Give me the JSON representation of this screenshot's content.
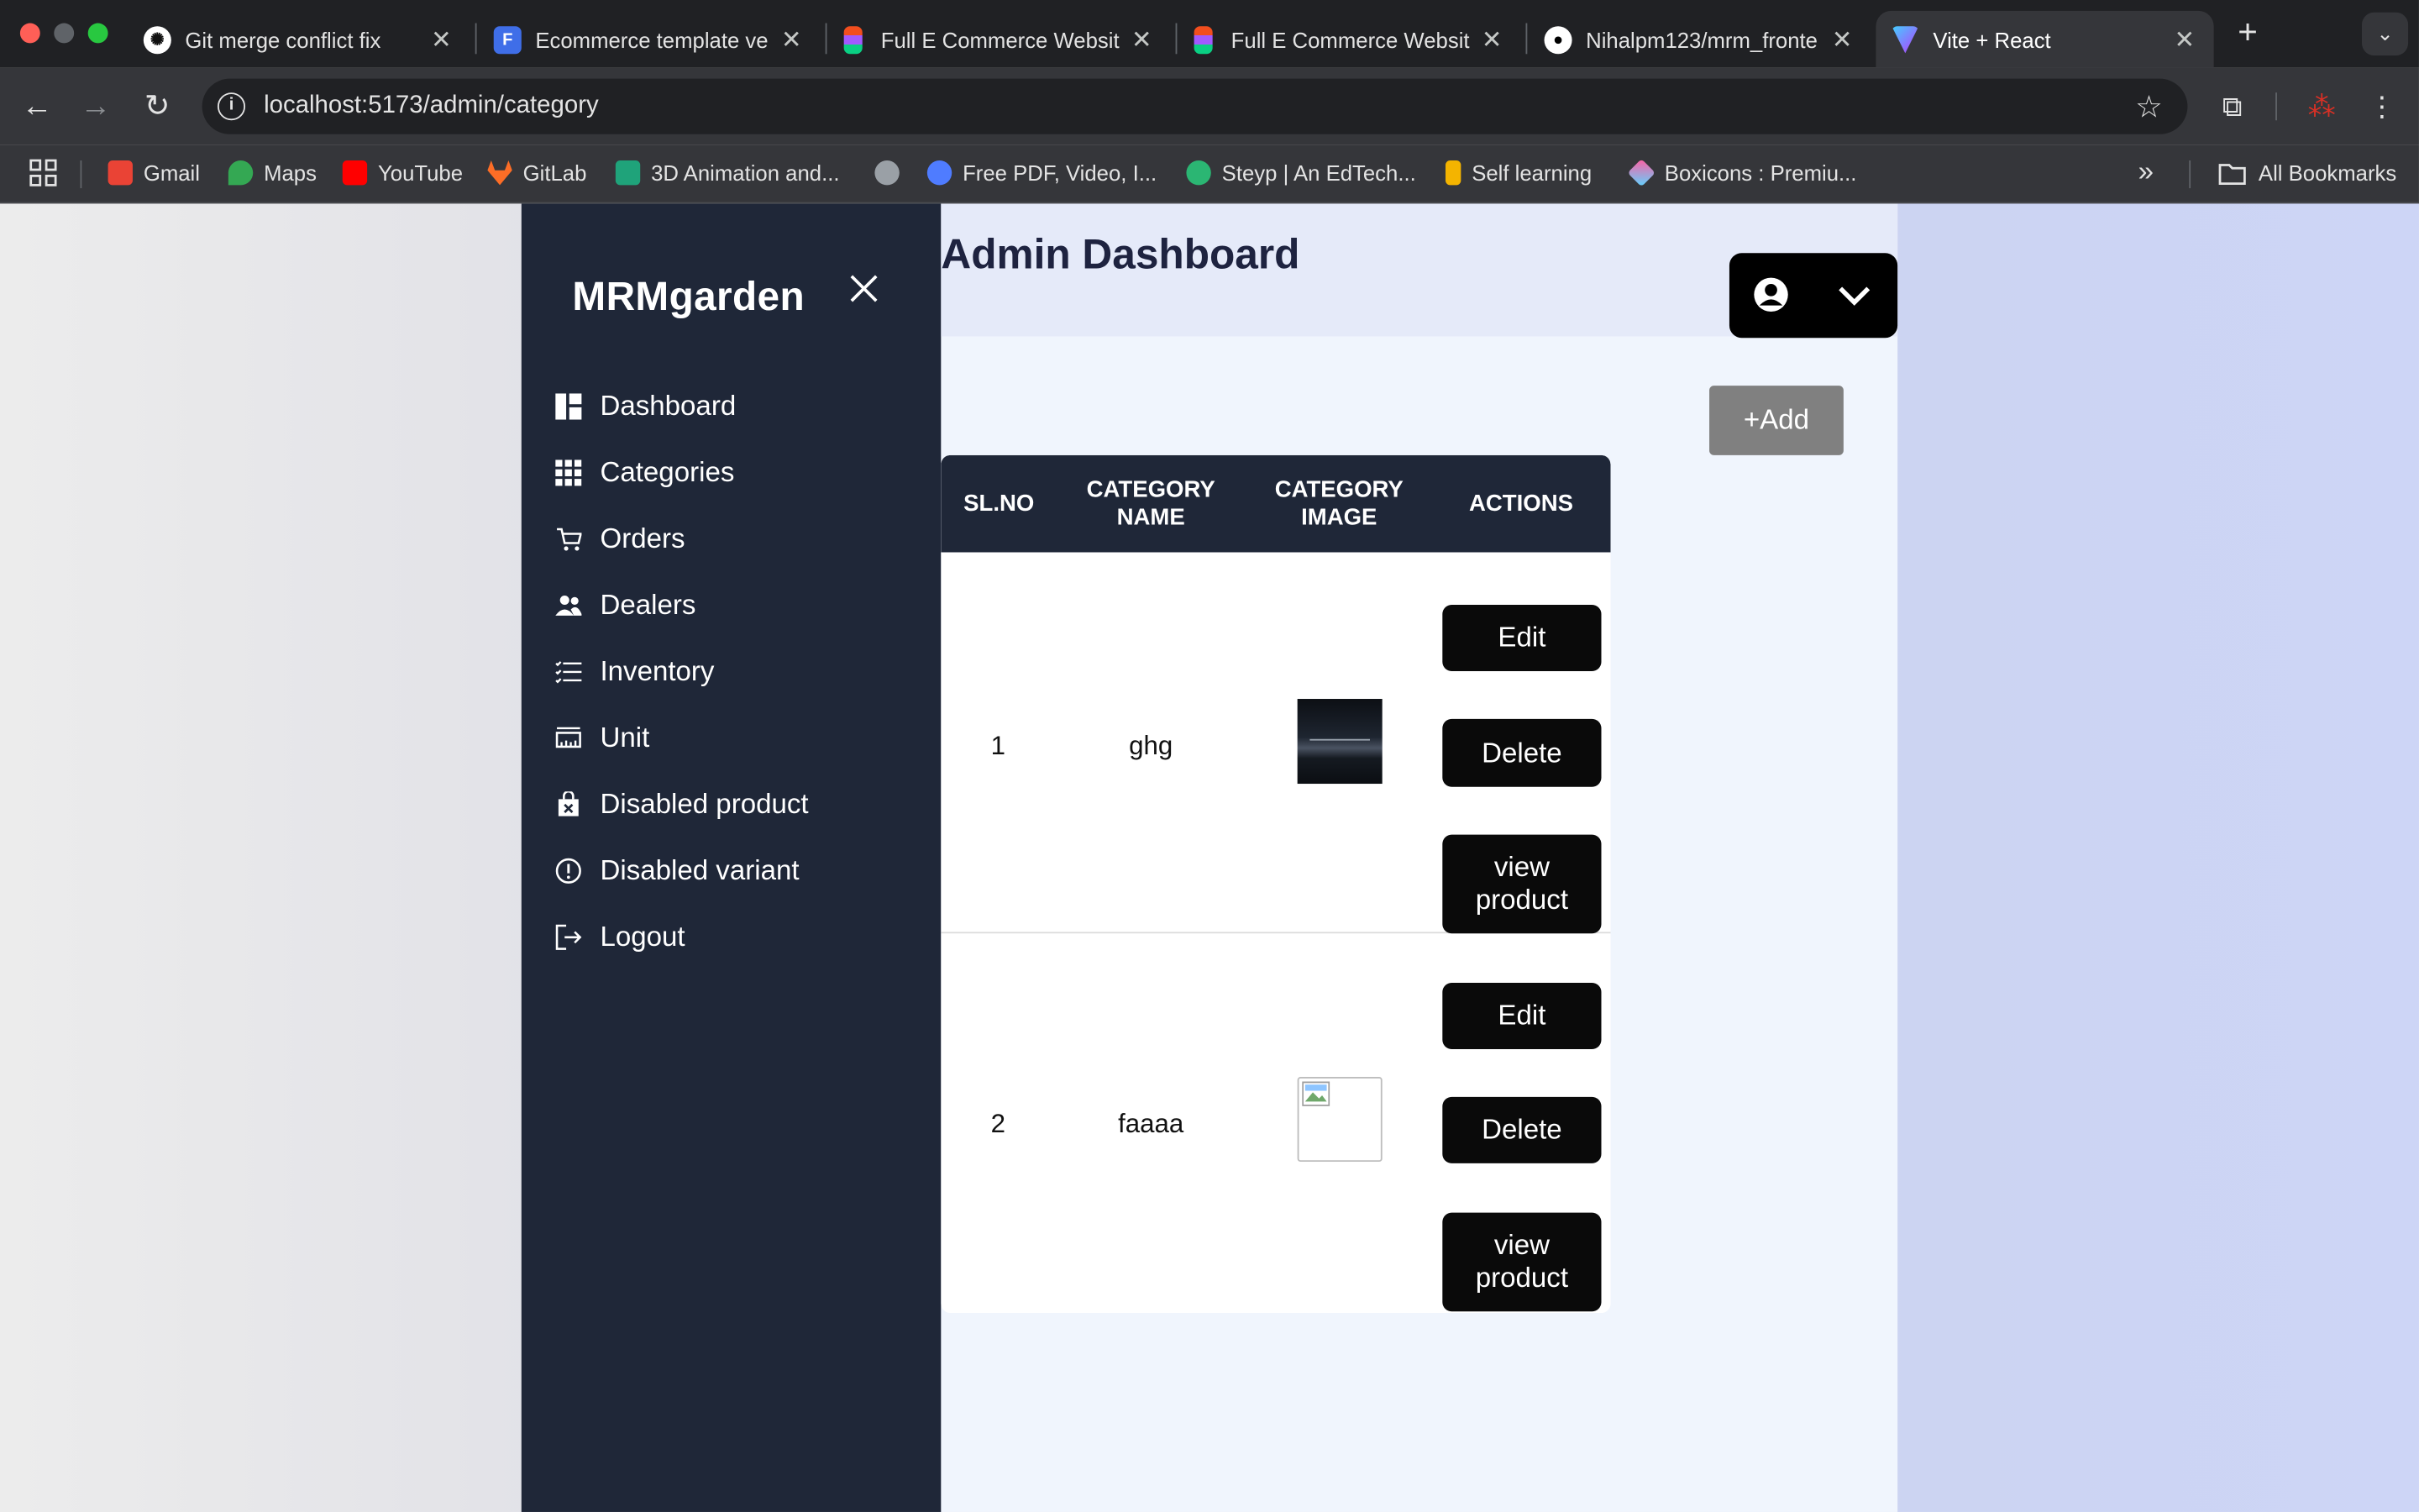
{
  "browser": {
    "tabs": [
      {
        "title": "Git merge conflict fix",
        "icon": "chatgpt-icon",
        "active": false
      },
      {
        "title": "Ecommerce template ve",
        "icon": "forms-icon",
        "active": false
      },
      {
        "title": "Full E Commerce Websit",
        "icon": "figma-icon",
        "active": false
      },
      {
        "title": "Full E Commerce Websit",
        "icon": "figma-icon",
        "active": false
      },
      {
        "title": "Nihalpm123/mrm_fronte",
        "icon": "github-icon",
        "active": false
      },
      {
        "title": "Vite + React",
        "icon": "vite-icon",
        "active": true
      }
    ],
    "url": "localhost:5173/admin/category",
    "bookmarks": [
      {
        "label": "Gmail",
        "color": "#ea4335"
      },
      {
        "label": "Maps",
        "color": "#34a853"
      },
      {
        "label": "YouTube",
        "color": "#ff0000"
      },
      {
        "label": "GitLab",
        "color": "#fc6d26"
      },
      {
        "label": "3D Animation and...",
        "color": "#1fa37a"
      },
      {
        "label": "",
        "color": "#9aa0a6"
      },
      {
        "label": "Free PDF, Video, I...",
        "color": "#4f7cff"
      },
      {
        "label": "Steyp | An EdTech...",
        "color": "#2bb673"
      },
      {
        "label": "Self learning",
        "color": "#f4b400"
      },
      {
        "label": "Boxicons : Premiu...",
        "color": "#ff5fa2"
      }
    ],
    "all_bookmarks": "All Bookmarks"
  },
  "sidebar": {
    "brand": "MRMgarden",
    "items": [
      {
        "label": "Dashboard",
        "icon": "dashboard-icon"
      },
      {
        "label": "Categories",
        "icon": "grid-icon"
      },
      {
        "label": "Orders",
        "icon": "cart-icon"
      },
      {
        "label": "Dealers",
        "icon": "users-icon"
      },
      {
        "label": "Inventory",
        "icon": "list-icon"
      },
      {
        "label": "Unit",
        "icon": "ruler-icon"
      },
      {
        "label": "Disabled product",
        "icon": "bag-x-icon"
      },
      {
        "label": "Disabled variant",
        "icon": "alert-circle-icon"
      },
      {
        "label": "Logout",
        "icon": "logout-icon"
      }
    ]
  },
  "header": {
    "title": "Admin Dashboard"
  },
  "add_button": "+Add",
  "table": {
    "columns": [
      "SL.NO",
      "CATEGORY NAME",
      "CATEGORY IMAGE",
      "ACTIONS"
    ],
    "rows": [
      {
        "sl": "1",
        "name": "ghg",
        "image": "loaded-thumbnail"
      },
      {
        "sl": "2",
        "name": "faaaa",
        "image": "broken-image"
      }
    ],
    "actions": {
      "edit": "Edit",
      "delete": "Delete",
      "view": "view product"
    }
  },
  "colors": {
    "sidebar_bg": "#1f2738",
    "main_bg": "#f0f5fd",
    "button_bg": "#0a0a0a",
    "add_bg": "#808080"
  }
}
